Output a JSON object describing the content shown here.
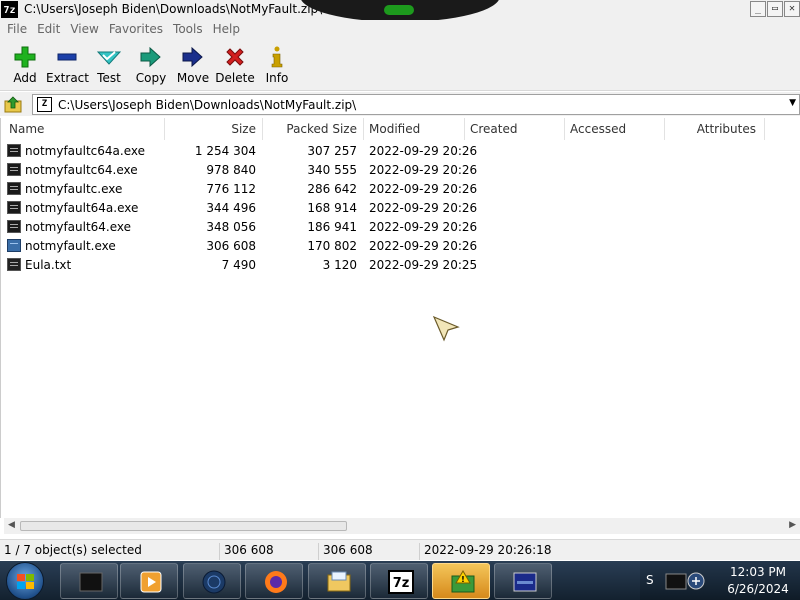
{
  "window": {
    "app_icon_text": "7z",
    "title": "C:\\Users\\Joseph Biden\\Downloads\\NotMyFault.zip\\"
  },
  "menu": [
    "File",
    "Edit",
    "View",
    "Favorites",
    "Tools",
    "Help"
  ],
  "toolbar": [
    {
      "label": "Add",
      "icon": "plus-icon",
      "color": "#1fb21f"
    },
    {
      "label": "Extract",
      "icon": "minus-icon",
      "color": "#1b3fa8"
    },
    {
      "label": "Test",
      "icon": "check-arrow-icon",
      "color": "#1ab0b0"
    },
    {
      "label": "Copy",
      "icon": "copy-arrow-icon",
      "color": "#1a9a7a"
    },
    {
      "label": "Move",
      "icon": "move-arrow-icon",
      "color": "#1b2f8c"
    },
    {
      "label": "Delete",
      "icon": "delete-x-icon",
      "color": "#d21f1f"
    },
    {
      "label": "Info",
      "icon": "info-icon",
      "color": "#c9a000"
    }
  ],
  "address": {
    "path": "C:\\Users\\Joseph Biden\\Downloads\\NotMyFault.zip\\"
  },
  "columns": [
    "Name",
    "Size",
    "Packed Size",
    "Modified",
    "Created",
    "Accessed",
    "Attributes"
  ],
  "files": [
    {
      "name": "notmyfaultc64a.exe",
      "size": "1 254 304",
      "packed": "307 257",
      "modified": "2022-09-29 20:26",
      "icon": "exe-dark"
    },
    {
      "name": "notmyfaultc64.exe",
      "size": "978 840",
      "packed": "340 555",
      "modified": "2022-09-29 20:26",
      "icon": "exe-dark"
    },
    {
      "name": "notmyfaultc.exe",
      "size": "776 112",
      "packed": "286 642",
      "modified": "2022-09-29 20:26",
      "icon": "exe-dark"
    },
    {
      "name": "notmyfault64a.exe",
      "size": "344 496",
      "packed": "168 914",
      "modified": "2022-09-29 20:26",
      "icon": "exe-dark"
    },
    {
      "name": "notmyfault64.exe",
      "size": "348 056",
      "packed": "186 941",
      "modified": "2022-09-29 20:26",
      "icon": "exe-dark"
    },
    {
      "name": "notmyfault.exe",
      "size": "306 608",
      "packed": "170 802",
      "modified": "2022-09-29 20:26",
      "icon": "exe-blue"
    },
    {
      "name": "Eula.txt",
      "size": "7 490",
      "packed": "3 120",
      "modified": "2022-09-29 20:25",
      "icon": "txt"
    }
  ],
  "status": {
    "selection": "1 / 7 object(s) selected",
    "size": "306 608",
    "packed": "306 608",
    "modified": "2022-09-29 20:26:18"
  },
  "taskbar": {
    "apps": [
      "cmd-icon",
      "media-player-icon",
      "globe-icon",
      "firefox-icon",
      "explorer-icon",
      "7zip-icon",
      "warning-app-icon",
      "remote-desktop-icon"
    ],
    "tray_text": "S",
    "clock_time": "12:03 PM",
    "clock_date": "6/26/2024"
  }
}
